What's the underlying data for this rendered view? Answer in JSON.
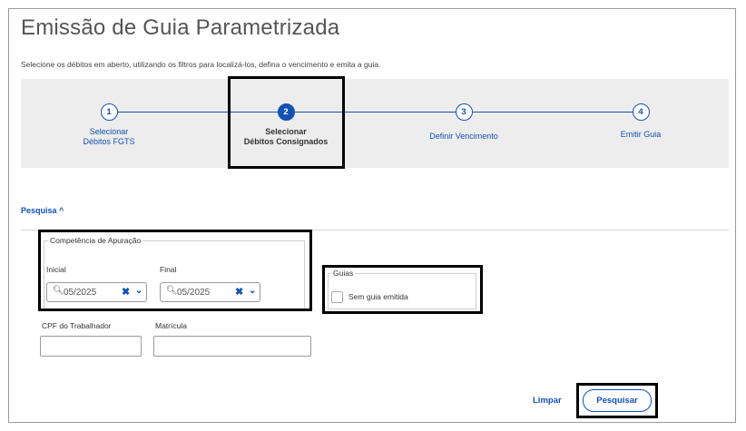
{
  "page": {
    "title": "Emissão de Guia Parametrizada",
    "subtitle": "Selecione os débitos em aberto, utilizando os filtros para localizá-los, defina o vencimento e emita a guia."
  },
  "stepper": {
    "steps": [
      {
        "number": "1",
        "line1": "Selecionar",
        "line2": "Débitos FGTS",
        "active": false
      },
      {
        "number": "2",
        "line1": "Selecionar",
        "line2": "Débitos Consignados",
        "active": true
      },
      {
        "number": "3",
        "line1": "Definir Vencimento",
        "line2": "",
        "active": false
      },
      {
        "number": "4",
        "line1": "Emitir Guia",
        "line2": "",
        "active": false
      }
    ]
  },
  "search": {
    "toggle_label": "Pesquisa",
    "toggle_icon": "^",
    "competencia_legend": "Competência de Apuração",
    "inicial_label": "Inicial",
    "inicial_value": "05/2025",
    "final_label": "Final",
    "final_value": "05/2025",
    "clear_glyph": "✖",
    "chevron_glyph": "⌄",
    "search_glyph": "🔍︎",
    "guias_legend": "Guias",
    "sem_guia_label": "Sem guia emitida",
    "cpf_label": "CPF do Trabalhador",
    "cpf_value": "",
    "matricula_label": "Matrícula",
    "matricula_value": ""
  },
  "actions": {
    "clear_label": "Limpar",
    "search_label": "Pesquisar"
  },
  "colors": {
    "accent": "#1351b4",
    "stepper_bg": "#ededed",
    "highlight_border": "#000000"
  }
}
